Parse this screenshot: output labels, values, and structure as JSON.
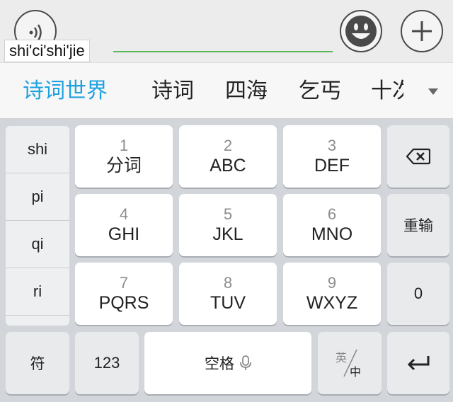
{
  "input": {
    "composing_text": "shi'ci'shi'jie"
  },
  "candidates": {
    "items": [
      "诗词世界",
      "诗词",
      "四海",
      "乞丐",
      "十次"
    ],
    "expand_icon": "chevron-down-icon"
  },
  "pinyin_list": [
    "shi",
    "pi",
    "qi",
    "ri"
  ],
  "keys": {
    "row1": [
      {
        "num": "1",
        "letters": "分词"
      },
      {
        "num": "2",
        "letters": "ABC"
      },
      {
        "num": "3",
        "letters": "DEF"
      }
    ],
    "row2": [
      {
        "num": "4",
        "letters": "GHI"
      },
      {
        "num": "5",
        "letters": "JKL"
      },
      {
        "num": "6",
        "letters": "MNO"
      }
    ],
    "row3": [
      {
        "num": "7",
        "letters": "PQRS"
      },
      {
        "num": "8",
        "letters": "TUV"
      },
      {
        "num": "9",
        "letters": "WXYZ"
      }
    ],
    "retype": "重输",
    "zero": "0",
    "symbol": "符",
    "numeric": "123",
    "space": "空格",
    "lang_en": "英",
    "lang_zh": "中"
  },
  "icons": {
    "voice": "voice-wave-icon",
    "emoji": "smiley-icon",
    "plus": "plus-icon",
    "backspace": "backspace-icon",
    "mic": "microphone-icon",
    "enter": "enter-icon"
  },
  "colors": {
    "accent": "#1da1e0",
    "underline": "#5cb85c"
  }
}
